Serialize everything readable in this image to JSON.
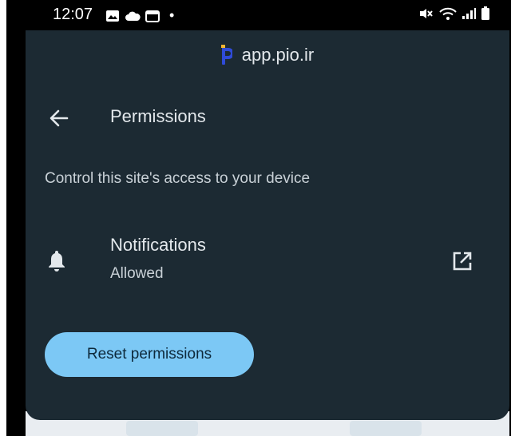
{
  "status_bar": {
    "time": "12:07",
    "dot": "•",
    "left_icons": [
      "gallery-icon",
      "cloud-icon",
      "calendar-icon"
    ],
    "right_icons": [
      "mute-icon",
      "wifi-icon",
      "signal-icon",
      "battery-icon"
    ]
  },
  "site": {
    "logo_icon": "pio-logo-icon",
    "domain": "app.pio.ir"
  },
  "header": {
    "title": "Permissions",
    "back_icon": "arrow-left-icon"
  },
  "description": "Control this site's access to your device",
  "permissions": [
    {
      "name": "Notifications",
      "status": "Allowed",
      "icon": "bell-icon",
      "action_icon": "open-external-icon"
    }
  ],
  "reset_button": {
    "label": "Reset permissions"
  },
  "colors": {
    "sheet_background": "#1c2a33",
    "primary_text": "#e3e8ec",
    "secondary_text": "#c9d1d7",
    "accent_button": "#7cc8f5",
    "accent_button_text": "#0e2a3c",
    "logo_color": "#2f4bd8"
  }
}
